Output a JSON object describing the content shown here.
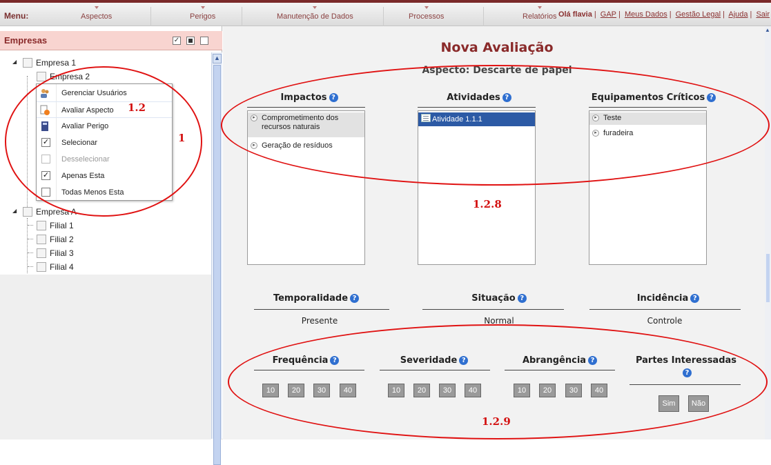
{
  "menu": {
    "label": "Menu:",
    "items": [
      "Aspectos",
      "Perigos",
      "Manutenção de Dados",
      "Processos",
      "Relatórios"
    ]
  },
  "user": {
    "greeting": "Olá flavia",
    "links": [
      "GAP",
      "Meus Dados",
      "Gestão Legal",
      "Ajuda",
      "Sair"
    ]
  },
  "left": {
    "title": "Empresas",
    "tree": {
      "empresa1": "Empresa 1",
      "empresa2": "Empresa 2",
      "empresaA": "Empresa A",
      "filiais": [
        "Filial 1",
        "Filial 2",
        "Filial 3",
        "Filial 4"
      ]
    },
    "context_menu": [
      {
        "label": "Gerenciar Usuários",
        "icon": "users-icon"
      },
      {
        "label": "Avaliar Aspecto",
        "icon": "document-plus-icon"
      },
      {
        "label": "Avaliar Perigo",
        "icon": "book-icon"
      },
      {
        "label": "Selecionar",
        "icon": "checkbox-checked-icon"
      },
      {
        "label": "Desselecionar",
        "icon": "checkbox-empty-icon"
      },
      {
        "label": "Apenas Esta",
        "icon": "checkbox-checked-icon"
      },
      {
        "label": "Todas Menos Esta",
        "icon": "checkbox-empty-icon"
      }
    ]
  },
  "annotations": {
    "a1": "1",
    "a12": "1.2",
    "a128": "1.2.8",
    "a129": "1.2.9"
  },
  "main": {
    "title": "Nova Avaliação",
    "aspect": "Aspecto: Descarte de papel",
    "impactos": {
      "label": "Impactos",
      "items": [
        "Comprometimento dos recursos naturais",
        "Geração de resíduos"
      ]
    },
    "atividades": {
      "label": "Atividades",
      "items": [
        "Atividade 1.1.1"
      ]
    },
    "equipamentos": {
      "label": "Equipamentos Críticos",
      "items": [
        "Teste",
        "furadeira"
      ]
    },
    "temporalidade": {
      "label": "Temporalidade",
      "value": "Presente"
    },
    "situacao": {
      "label": "Situação",
      "value": "Normal"
    },
    "incidencia": {
      "label": "Incidência",
      "value": "Controle"
    },
    "frequencia": {
      "label": "Frequência",
      "options": [
        "10",
        "20",
        "30",
        "40"
      ]
    },
    "severidade": {
      "label": "Severidade",
      "options": [
        "10",
        "20",
        "30",
        "40"
      ]
    },
    "abrangencia": {
      "label": "Abrangência",
      "options": [
        "10",
        "20",
        "30",
        "40"
      ]
    },
    "partes": {
      "label": "Partes Interessadas",
      "options": [
        "Sim",
        "Não"
      ]
    },
    "help_glyph": "?"
  },
  "colors": {
    "accent": "#8a2a2a",
    "annotation": "#e01212",
    "selected": "#2c5aa5",
    "help": "#2f6fd0"
  }
}
